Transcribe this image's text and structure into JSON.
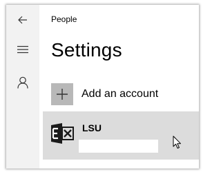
{
  "app": {
    "title": "People"
  },
  "nav": {
    "back_icon": "back-arrow-icon",
    "menu_icon": "hamburger-menu-icon",
    "account_icon": "person-icon"
  },
  "page": {
    "title": "Settings"
  },
  "add_account": {
    "label": "Add an account",
    "icon": "plus-icon"
  },
  "accounts": [
    {
      "name": "LSU",
      "icon": "exchange-icon",
      "email": ""
    }
  ],
  "colors": {
    "rail_background": "#f2f2f2",
    "add_icon_background": "#b8b8b8",
    "selected_row_background": "#dcdcdc"
  }
}
